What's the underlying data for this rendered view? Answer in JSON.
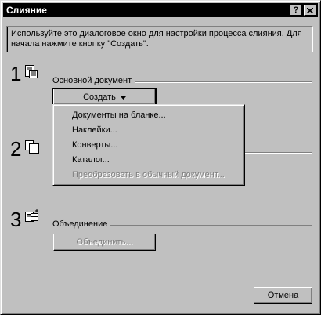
{
  "window": {
    "title": "Слияние",
    "help_label": "?",
    "close_label": "×"
  },
  "info": {
    "text": "Используйте это диалоговое окно для настройки процесса слияния. Для начала нажмите кнопку \"Создать\"."
  },
  "steps": [
    {
      "number": "1",
      "icon": "main-document-icon",
      "group_label": "Основной документ",
      "button_label": "Создать"
    },
    {
      "number": "2",
      "icon": "data-source-icon"
    },
    {
      "number": "3",
      "icon": "merge-icon",
      "group_label": "Объединение",
      "button_label": "Объединить..."
    }
  ],
  "create_menu": {
    "items": [
      {
        "label": "Документы на бланке...",
        "enabled": true
      },
      {
        "label": "Наклейки...",
        "enabled": true
      },
      {
        "label": "Конверты...",
        "enabled": true
      },
      {
        "label": "Каталог...",
        "enabled": true
      },
      {
        "label": "Преобразовать в обычный документ...",
        "enabled": false
      }
    ]
  },
  "footer": {
    "cancel_label": "Отмена"
  }
}
